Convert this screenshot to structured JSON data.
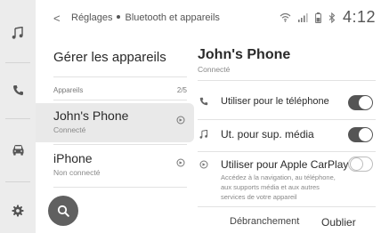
{
  "breadcrumb": {
    "back": "<",
    "parent": "Réglages",
    "current": "Bluetooth et appareils"
  },
  "status": {
    "time": "4:12",
    "icons": [
      "wifi-icon",
      "signal-icon",
      "battery-icon",
      "bluetooth-icon"
    ]
  },
  "rail": {
    "items": [
      "music-icon",
      "phone-icon",
      "car-icon",
      "gear-icon"
    ]
  },
  "left": {
    "title": "Gérer les appareils",
    "section_label": "Appareils",
    "section_count": "2/5",
    "devices": [
      {
        "name": "John's Phone",
        "status": "Connecté",
        "selected": true,
        "icon": "carplay-icon"
      },
      {
        "name": "iPhone",
        "status": "Non connecté",
        "selected": false,
        "icon": "carplay-icon"
      }
    ],
    "search_icon": "search-icon"
  },
  "right": {
    "title": "John's Phone",
    "subtitle": "Connecté",
    "options": [
      {
        "label": "Utiliser pour le téléphone",
        "icon": "phone-icon",
        "on": true
      },
      {
        "label": "Ut. pour sup. média",
        "icon": "music-icon",
        "on": true
      },
      {
        "label": "Utiliser pour Apple CarPlay",
        "icon": "carplay-icon",
        "on": false,
        "desc": "Accédez à la navigation, au téléphone, aux supports média et aux autres services de votre appareil"
      }
    ],
    "disconnect_label": "Débranchement",
    "forget_label": "Oublier"
  },
  "colors": {
    "rail_bg": "#ececec",
    "selected_bg": "#e9e9e9",
    "toggle_on": "#555555",
    "fab": "#606060"
  }
}
